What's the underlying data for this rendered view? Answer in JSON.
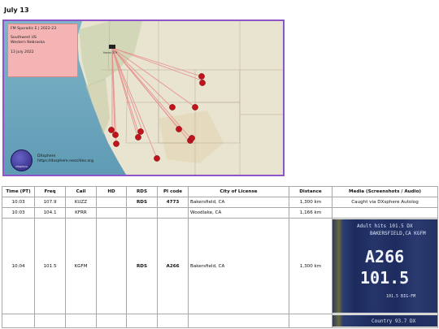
{
  "page": {
    "heading": "July 13"
  },
  "map": {
    "caption": {
      "title": "FM Sporadic E  |  2022-23",
      "region_line1": "Southwest US",
      "region_line2": "Western Nebraska",
      "date": "13 July 2022"
    },
    "logo": {
      "badge_text": "DXsphere",
      "name": "DXsphere",
      "url": "https://dxsphere.neocities.org"
    },
    "home_label": "Home QTH"
  },
  "table": {
    "headers": [
      "Time (PT)",
      "Freq",
      "Call",
      "HD",
      "RDS",
      "PI code",
      "City of License",
      "Distance",
      "Media (Screenshots / Audio)"
    ],
    "rows": [
      {
        "time": "10:03",
        "freq": "107.9",
        "call": "KUZZ",
        "hd": "",
        "rds": "RDS",
        "pi": "4773",
        "city": "Bakersfield, CA",
        "distance": "1,300 km",
        "media": "Caught via DXsphere Autolog"
      },
      {
        "time": "10:03",
        "freq": "104.1",
        "call": "KFRR",
        "hd": "",
        "rds": "",
        "pi": "",
        "city": "Woodlake, CA",
        "distance": "1,166 km",
        "media": ""
      },
      {
        "time": "10:04",
        "freq": "101.5",
        "call": "KGFM",
        "hd": "",
        "rds": "RDS",
        "pi": "A266",
        "city": "Bakersfield, CA",
        "distance": "1,300 km",
        "media_screen": {
          "line1": "Adult hits   101.5  DX",
          "line2": "BAKERSFIELD,CA  KGFM",
          "pi": "A266",
          "freq": "101.5",
          "ps": "101.5 BIG-FM"
        }
      },
      {
        "time": "",
        "freq": "",
        "call": "",
        "hd": "",
        "rds": "",
        "pi": "",
        "city": "",
        "distance": "",
        "media_screen": {
          "line1": "Country   93.7  DX"
        }
      }
    ]
  },
  "colors": {
    "map_border": "#8f55c8",
    "caption_bg": "#f4b4b4",
    "marker": "#c0131b",
    "path": "#e88a8a",
    "water": "#7ab0c6",
    "land": "#e9e6d2"
  }
}
